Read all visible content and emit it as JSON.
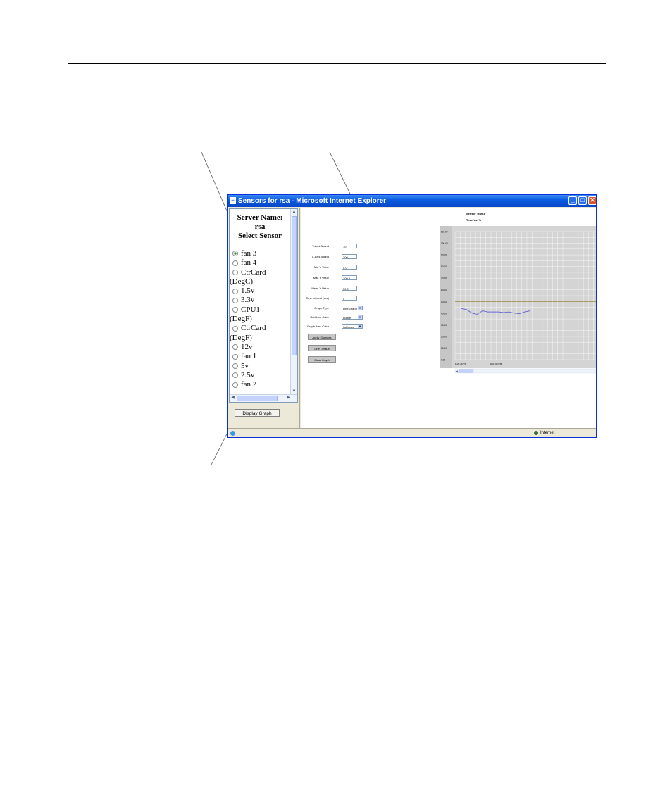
{
  "window": {
    "title": "Sensors for rsa - Microsoft Internet Explorer",
    "icon": "ie-page-icon"
  },
  "sidebar": {
    "server_label": "Server Name:",
    "server_value": "rsa",
    "select_label": "Select Sensor",
    "sensors": [
      {
        "label": "fan 3",
        "selected": true
      },
      {
        "label": "fan 4",
        "selected": false
      },
      {
        "label": "CtrCard",
        "cont": "(DegC)",
        "selected": false
      },
      {
        "label": "1.5v",
        "selected": false
      },
      {
        "label": "3.3v",
        "selected": false
      },
      {
        "label": "CPU1",
        "cont": "(DegF)",
        "selected": false
      },
      {
        "label": "CtrCard",
        "cont": "(DegF)",
        "selected": false
      },
      {
        "label": "12v",
        "selected": false
      },
      {
        "label": "fan 1",
        "selected": false
      },
      {
        "label": "5v",
        "selected": false
      },
      {
        "label": "2.5v",
        "selected": false
      },
      {
        "label": "fan 2",
        "selected": false
      }
    ],
    "display_button": "Display Graph"
  },
  "settings": {
    "fields": [
      {
        "label": "Y-Axis Bound",
        "value": "10"
      },
      {
        "label": "X-Axis Bound",
        "value": "200"
      },
      {
        "label": "Min Y Value",
        "value": "0.0"
      },
      {
        "label": "Max Y Value",
        "value": "100.0"
      },
      {
        "label": "Mean Y Value",
        "value": "50.0"
      },
      {
        "label": "Time Interval (sec)",
        "value": "5"
      }
    ],
    "selects": [
      {
        "label": "Graph Type",
        "value": "Line Graph"
      },
      {
        "label": "Grid Line Color",
        "value": "purple"
      },
      {
        "label": "Graph Area Color",
        "value": "lightgray"
      }
    ],
    "buttons": [
      "Apply Changes",
      "Line Default",
      "Clear Graph"
    ]
  },
  "chart_header": {
    "sensor": "Sensor : fan 3",
    "units": "Time Vs. %"
  },
  "chart_data": {
    "type": "line",
    "ylim": [
      0,
      110
    ],
    "y_ticks": [
      "110.00",
      "100.00",
      "90.00",
      "80.00",
      "70.00",
      "60.00",
      "50.00",
      "40.00",
      "30.00",
      "20.00",
      "10.00",
      "0.00"
    ],
    "x_tick_labels": [
      "8:20:36 PM",
      "8:20:56 PM"
    ],
    "mean_line": 50.0,
    "colors": {
      "line": "#6b6bd6",
      "mean": "#8a7a2a",
      "grid": "#ffffff",
      "area": "#d4d4d4"
    },
    "series": [
      {
        "values": [
          44.0,
          43.0,
          40.0,
          39.0,
          42.0,
          41.0,
          41.0,
          41.0,
          40.5,
          41.0,
          40.0,
          39.5,
          41.0,
          42.0
        ]
      }
    ]
  },
  "status_bar": {
    "zone": "Internet"
  }
}
